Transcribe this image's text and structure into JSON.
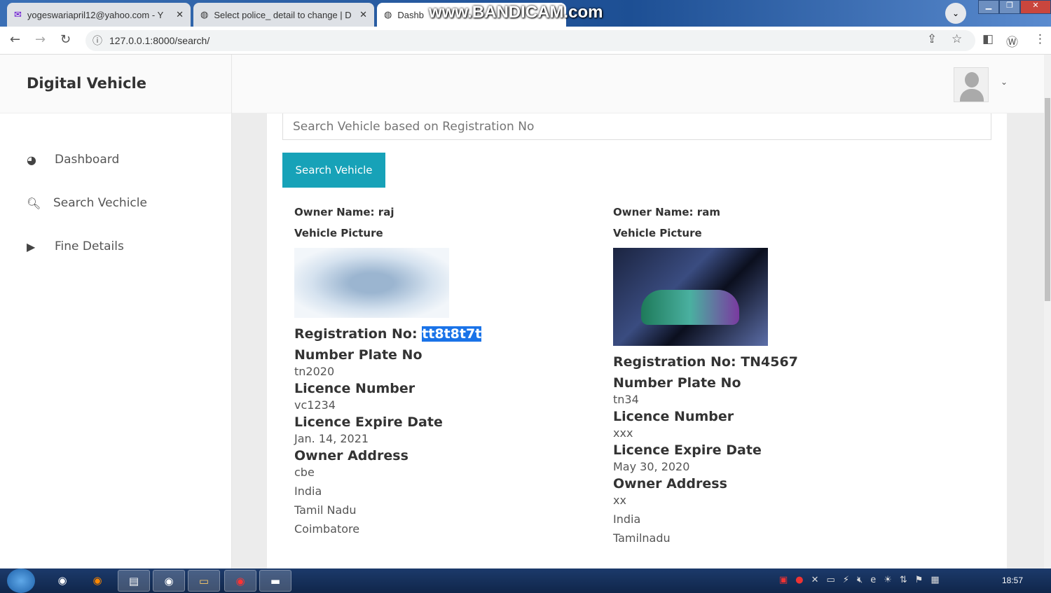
{
  "browser": {
    "tabs": [
      {
        "title": "yogeswariapril12@yahoo.com - Y"
      },
      {
        "title": "Select police_ detail to change | D"
      },
      {
        "title": "Dashb"
      }
    ],
    "url": "127.0.0.1:8000/search/",
    "watermark": "www.BANDICAM.com"
  },
  "sidebar": {
    "brand": "Digital Vehicle",
    "items": [
      {
        "label": "Dashboard",
        "icon": "dashboard-icon"
      },
      {
        "label": "Search Vechicle",
        "icon": "search-icon"
      },
      {
        "label": "Fine Details",
        "icon": "play-square-icon"
      }
    ]
  },
  "search": {
    "placeholder": "Search Vehicle based on Registration No",
    "button": "Search Vehicle"
  },
  "labels": {
    "owner_name": "Owner Name:",
    "vehicle_picture": "Vehicle Picture",
    "registration": "Registration No:",
    "plate": "Number Plate No",
    "licence": "Licence Number",
    "expire": "Licence Expire Date",
    "address": "Owner Address"
  },
  "results": [
    {
      "owner": "raj",
      "registration": "tt8t8t7t",
      "plate": "tn2020",
      "licence": "vc1234",
      "expire": "Jan. 14, 2021",
      "address": [
        "cbe",
        "India",
        "Tamil Nadu",
        "Coimbatore"
      ]
    },
    {
      "owner": "ram",
      "registration": "TN4567",
      "plate": "tn34",
      "licence": "xxx",
      "expire": "May 30, 2020",
      "address": [
        "xx",
        "India",
        "Tamilnadu"
      ]
    }
  ],
  "taskbar": {
    "clock": "18:57"
  },
  "colors": {
    "accent": "#17a2b8"
  }
}
